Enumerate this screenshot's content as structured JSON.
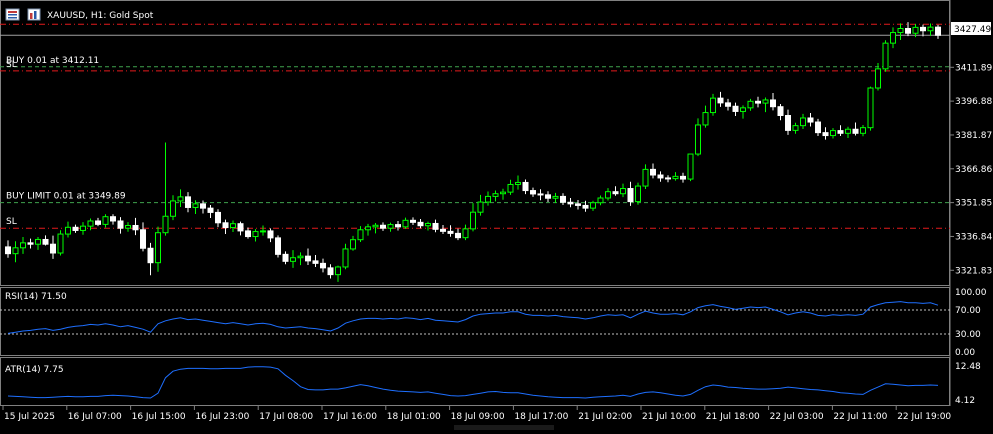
{
  "header": {
    "title": "XAUUSD, H1:  Gold Spot",
    "icons": [
      "chart-menu-icon",
      "one-click-trading-icon"
    ]
  },
  "price_panel": {
    "current_price_label": "3427.49",
    "price_ticks": [
      "3411.89",
      "3396.88",
      "3381.87",
      "3366.86",
      "3351.85",
      "3336.84",
      "3321.83"
    ],
    "order_lines": [
      {
        "label": "BUY 0.01 at 3412.11",
        "price": 3412.11,
        "kind": "entry",
        "color": "#3fa34d"
      },
      {
        "label": "SL",
        "price": 3410.3,
        "kind": "stop",
        "color": "#e31a1c"
      },
      {
        "label": "BUY LIMIT 0.01 at 3349.89",
        "price": 3351.85,
        "kind": "entry",
        "color": "#3fa34d"
      },
      {
        "label": "SL",
        "price": 3340.5,
        "kind": "stop",
        "color": "#e31a1c"
      }
    ],
    "top_red_price": 3431.0
  },
  "rsi_panel": {
    "label": "RSI(14) 71.50",
    "ticks": [
      "100.00",
      "70.00",
      "30.00",
      "0.00"
    ],
    "levels": [
      70,
      30
    ]
  },
  "atr_panel": {
    "label": "ATR(14) 7.75",
    "ticks": [
      "12.48",
      "4.12"
    ]
  },
  "time_axis": {
    "labels": [
      "15 Jul 2025",
      "16 Jul 07:00",
      "16 Jul 15:00",
      "16 Jul 23:00",
      "17 Jul 08:00",
      "17 Jul 16:00",
      "18 Jul 01:00",
      "18 Jul 09:00",
      "18 Jul 17:00",
      "21 Jul 02:00",
      "21 Jul 10:00",
      "21 Jul 18:00",
      "22 Jul 03:00",
      "22 Jul 11:00",
      "22 Jul 19:00"
    ]
  },
  "colors": {
    "bull": "#00ff00",
    "bear": "#ffffff",
    "background": "#000000",
    "indicator_line": "#1e6fff",
    "grid_dotted": "#c0c0c0",
    "current_price_line": "#a0a0a0"
  },
  "chart_data": {
    "type": "candlestick",
    "symbol": "XAUUSD",
    "timeframe": "H1",
    "ylim": [
      3315.3,
      3441.3
    ],
    "candles": [
      [
        3332.2,
        3335.1,
        3327.4,
        3329.2
      ],
      [
        3329.2,
        3334.7,
        3325.4,
        3331.8
      ],
      [
        3331.8,
        3336.6,
        3329.1,
        3334.0
      ],
      [
        3334.0,
        3335.9,
        3331.5,
        3333.4
      ],
      [
        3333.4,
        3336.6,
        3330.9,
        3335.5
      ],
      [
        3335.5,
        3337.3,
        3332.8,
        3333.4
      ],
      [
        3333.4,
        3337.2,
        3326.9,
        3329.5
      ],
      [
        3329.5,
        3339.6,
        3328.4,
        3337.9
      ],
      [
        3337.9,
        3343.4,
        3336.4,
        3340.9
      ],
      [
        3340.9,
        3342.1,
        3338.4,
        3339.5
      ],
      [
        3339.5,
        3343.2,
        3337.6,
        3341.4
      ],
      [
        3341.4,
        3344.8,
        3339.6,
        3343.7
      ],
      [
        3343.7,
        3345.1,
        3341.4,
        3342.2
      ],
      [
        3342.2,
        3346.7,
        3340.8,
        3345.6
      ],
      [
        3345.6,
        3346.7,
        3342.1,
        3343.7
      ],
      [
        3343.7,
        3345.4,
        3338.1,
        3340.5
      ],
      [
        3340.5,
        3343.2,
        3338.9,
        3341.7
      ],
      [
        3341.7,
        3345.1,
        3337.4,
        3339.8
      ],
      [
        3339.8,
        3343.1,
        3330.2,
        3331.6
      ],
      [
        3331.6,
        3334.0,
        3319.6,
        3325.2
      ],
      [
        3325.2,
        3341.2,
        3321.2,
        3338.5
      ],
      [
        3338.5,
        3378.5,
        3337.2,
        3345.8
      ],
      [
        3345.8,
        3355.1,
        3344.1,
        3352.6
      ],
      [
        3352.6,
        3357.7,
        3349.9,
        3354.4
      ],
      [
        3354.4,
        3356.5,
        3347.6,
        3349.7
      ],
      [
        3349.7,
        3352.9,
        3346.8,
        3351.3
      ],
      [
        3351.3,
        3352.8,
        3347.0,
        3349.4
      ],
      [
        3349.4,
        3350.8,
        3345.0,
        3347.5
      ],
      [
        3347.5,
        3348.9,
        3341.0,
        3342.9
      ],
      [
        3342.9,
        3344.3,
        3337.9,
        3340.8
      ],
      [
        3340.8,
        3343.9,
        3338.8,
        3342.5
      ],
      [
        3342.5,
        3343.4,
        3337.3,
        3339.3
      ],
      [
        3339.3,
        3340.8,
        3335.9,
        3336.8
      ],
      [
        3336.8,
        3340.1,
        3334.6,
        3339.0
      ],
      [
        3339.0,
        3341.7,
        3337.2,
        3339.3
      ],
      [
        3339.3,
        3340.4,
        3334.3,
        3336.2
      ],
      [
        3336.2,
        3337.3,
        3327.5,
        3328.9
      ],
      [
        3328.9,
        3330.2,
        3324.5,
        3325.8
      ],
      [
        3325.8,
        3330.8,
        3322.9,
        3327.4
      ],
      [
        3327.4,
        3329.8,
        3324.1,
        3328.1
      ],
      [
        3328.1,
        3331.5,
        3324.2,
        3326.0
      ],
      [
        3326.0,
        3328.6,
        3323.3,
        3324.9
      ],
      [
        3324.9,
        3327.0,
        3320.9,
        3322.9
      ],
      [
        3322.9,
        3324.5,
        3318.2,
        3319.9
      ],
      [
        3319.9,
        3323.9,
        3316.7,
        3323.3
      ],
      [
        3323.3,
        3333.6,
        3322.3,
        3331.3
      ],
      [
        3331.3,
        3337.1,
        3330.5,
        3335.4
      ],
      [
        3335.4,
        3341.4,
        3334.4,
        3339.8
      ],
      [
        3339.8,
        3342.4,
        3337.2,
        3341.1
      ],
      [
        3341.1,
        3342.8,
        3338.2,
        3341.8
      ],
      [
        3341.8,
        3343.1,
        3339.3,
        3340.5
      ],
      [
        3340.5,
        3343.0,
        3338.9,
        3342.1
      ],
      [
        3342.1,
        3343.7,
        3339.5,
        3341.1
      ],
      [
        3341.1,
        3345.2,
        3340.2,
        3344.0
      ],
      [
        3344.0,
        3345.3,
        3341.9,
        3343.1
      ],
      [
        3343.1,
        3344.6,
        3340.5,
        3341.6
      ],
      [
        3341.6,
        3343.4,
        3339.5,
        3342.6
      ],
      [
        3342.6,
        3344.3,
        3338.7,
        3340.0
      ],
      [
        3340.0,
        3341.9,
        3337.9,
        3339.1
      ],
      [
        3339.1,
        3341.8,
        3336.7,
        3338.2
      ],
      [
        3338.2,
        3340.3,
        3335.2,
        3336.3
      ],
      [
        3336.3,
        3342.1,
        3335.2,
        3340.2
      ],
      [
        3340.2,
        3351.6,
        3339.1,
        3347.6
      ],
      [
        3347.6,
        3355.3,
        3346.1,
        3352.1
      ],
      [
        3352.1,
        3356.8,
        3350.5,
        3354.6
      ],
      [
        3354.6,
        3357.2,
        3352.4,
        3355.8
      ],
      [
        3355.8,
        3358.0,
        3353.1,
        3356.5
      ],
      [
        3356.5,
        3362.0,
        3355.3,
        3359.9
      ],
      [
        3359.9,
        3363.9,
        3357.6,
        3360.8
      ],
      [
        3360.8,
        3362.1,
        3355.6,
        3357.2
      ],
      [
        3357.2,
        3358.5,
        3354.4,
        3355.7
      ],
      [
        3355.7,
        3357.8,
        3352.9,
        3355.3
      ],
      [
        3355.3,
        3356.9,
        3352.1,
        3353.8
      ],
      [
        3353.8,
        3356.2,
        3351.8,
        3354.6
      ],
      [
        3354.6,
        3356.0,
        3350.8,
        3352.0
      ],
      [
        3352.0,
        3353.9,
        3349.8,
        3351.3
      ],
      [
        3351.3,
        3353.0,
        3348.8,
        3350.6
      ],
      [
        3350.6,
        3352.7,
        3347.8,
        3349.4
      ],
      [
        3349.4,
        3352.7,
        3348.2,
        3351.8
      ],
      [
        3351.8,
        3355.0,
        3350.7,
        3353.9
      ],
      [
        3353.9,
        3358.3,
        3352.8,
        3356.7
      ],
      [
        3356.7,
        3359.1,
        3354.9,
        3355.8
      ],
      [
        3355.8,
        3360.3,
        3354.3,
        3358.1
      ],
      [
        3358.1,
        3361.1,
        3350.4,
        3352.3
      ],
      [
        3352.3,
        3360.7,
        3350.9,
        3359.2
      ],
      [
        3359.2,
        3368.8,
        3357.9,
        3366.6
      ],
      [
        3366.6,
        3369.2,
        3362.6,
        3364.1
      ],
      [
        3364.1,
        3365.7,
        3361.1,
        3362.8
      ],
      [
        3362.8,
        3364.0,
        3360.9,
        3362.5
      ],
      [
        3362.5,
        3365.4,
        3361.6,
        3363.5
      ],
      [
        3363.5,
        3365.1,
        3360.7,
        3362.3
      ],
      [
        3362.3,
        3369.3,
        3361.4,
        3373.4
      ],
      [
        3373.4,
        3389.2,
        3372.5,
        3386.3
      ],
      [
        3386.3,
        3394.9,
        3385.1,
        3391.8
      ],
      [
        3391.8,
        3400.1,
        3390.4,
        3398.2
      ],
      [
        3398.2,
        3401.0,
        3394.3,
        3396.1
      ],
      [
        3396.1,
        3397.9,
        3392.7,
        3394.6
      ],
      [
        3394.6,
        3396.2,
        3390.3,
        3392.3
      ],
      [
        3392.3,
        3395.0,
        3389.1,
        3393.9
      ],
      [
        3393.9,
        3397.9,
        3392.6,
        3396.8
      ],
      [
        3396.8,
        3398.8,
        3394.1,
        3396.0
      ],
      [
        3396.0,
        3398.5,
        3392.0,
        3397.4
      ],
      [
        3397.4,
        3400.5,
        3392.8,
        3394.4
      ],
      [
        3394.4,
        3395.6,
        3388.4,
        3390.5
      ],
      [
        3390.5,
        3393.1,
        3381.9,
        3383.9
      ],
      [
        3383.9,
        3387.3,
        3382.4,
        3386.0
      ],
      [
        3386.0,
        3391.2,
        3384.5,
        3389.4
      ],
      [
        3389.4,
        3391.6,
        3385.6,
        3387.6
      ],
      [
        3387.6,
        3389.0,
        3381.4,
        3382.9
      ],
      [
        3382.9,
        3385.3,
        3379.8,
        3381.6
      ],
      [
        3381.6,
        3384.9,
        3380.3,
        3383.8
      ],
      [
        3383.8,
        3386.2,
        3381.4,
        3382.6
      ],
      [
        3382.6,
        3385.5,
        3380.5,
        3384.4
      ],
      [
        3384.4,
        3387.4,
        3381.6,
        3382.6
      ],
      [
        3382.6,
        3386.3,
        3381.3,
        3385.1
      ],
      [
        3385.1,
        3403.3,
        3383.8,
        3402.7
      ],
      [
        3402.7,
        3413.8,
        3401.6,
        3411.2
      ],
      [
        3411.2,
        3423.9,
        3409.9,
        3422.6
      ],
      [
        3422.6,
        3429.6,
        3420.4,
        3427.3
      ],
      [
        3427.3,
        3431.4,
        3424.0,
        3429.1
      ],
      [
        3429.1,
        3431.9,
        3425.7,
        3427.0
      ],
      [
        3427.0,
        3431.1,
        3425.3,
        3429.6
      ],
      [
        3429.6,
        3430.8,
        3425.6,
        3428.1
      ],
      [
        3428.1,
        3431.3,
        3425.8,
        3429.7
      ],
      [
        3429.7,
        3430.7,
        3424.5,
        3426.1
      ]
    ],
    "rsi": [
      31,
      33,
      35,
      36,
      38,
      39,
      36,
      38,
      41,
      43,
      44,
      46,
      45,
      47,
      45,
      42,
      44,
      41,
      38,
      33,
      47,
      52,
      55,
      57,
      54,
      55,
      53,
      51,
      49,
      47,
      49,
      47,
      45,
      47,
      48,
      46,
      42,
      40,
      41,
      42,
      40,
      39,
      37,
      35,
      40,
      48,
      52,
      55,
      56,
      56,
      55,
      56,
      55,
      57,
      56,
      54,
      56,
      53,
      52,
      51,
      50,
      54,
      60,
      63,
      64,
      65,
      65,
      67,
      67,
      63,
      61,
      61,
      60,
      61,
      59,
      58,
      57,
      55,
      57,
      60,
      62,
      61,
      62,
      57,
      63,
      68,
      65,
      63,
      63,
      64,
      62,
      67,
      74,
      77,
      79,
      76,
      74,
      71,
      73,
      75,
      74,
      75,
      71,
      67,
      62,
      65,
      67,
      65,
      61,
      60,
      62,
      61,
      62,
      61,
      63,
      75,
      79,
      82,
      83,
      84,
      82,
      82,
      81,
      82,
      78
    ],
    "atr": [
      5.1,
      5.0,
      4.9,
      4.8,
      4.7,
      4.7,
      4.8,
      4.9,
      5.0,
      4.9,
      4.9,
      5.0,
      5.0,
      5.2,
      5.3,
      5.2,
      5.1,
      4.9,
      4.7,
      4.6,
      5.8,
      9.6,
      11.2,
      11.7,
      11.9,
      11.9,
      11.9,
      11.8,
      11.8,
      11.9,
      11.9,
      11.9,
      12.2,
      12.3,
      12.3,
      12.2,
      11.8,
      10.2,
      8.9,
      7.4,
      6.7,
      6.6,
      6.6,
      6.8,
      6.8,
      7.1,
      7.5,
      7.9,
      7.6,
      7.2,
      6.8,
      6.5,
      6.3,
      6.2,
      6.1,
      6.0,
      6.1,
      5.8,
      5.5,
      5.2,
      5.1,
      5.2,
      5.5,
      5.8,
      6.1,
      6.2,
      6.0,
      5.9,
      5.9,
      5.6,
      5.3,
      5.1,
      4.9,
      4.8,
      4.7,
      4.7,
      4.7,
      4.6,
      4.8,
      4.9,
      5.0,
      5.1,
      5.3,
      5.0,
      5.6,
      6.0,
      6.1,
      5.9,
      5.6,
      5.3,
      5.1,
      5.5,
      6.5,
      7.4,
      7.8,
      7.6,
      7.3,
      7.2,
      7.0,
      6.9,
      6.8,
      6.8,
      6.9,
      7.0,
      7.3,
      7.1,
      6.9,
      6.7,
      6.6,
      6.4,
      6.2,
      5.9,
      5.8,
      5.6,
      5.5,
      6.5,
      7.3,
      8.1,
      8.0,
      7.8,
      7.6,
      7.7,
      7.7,
      7.8,
      7.7
    ]
  }
}
